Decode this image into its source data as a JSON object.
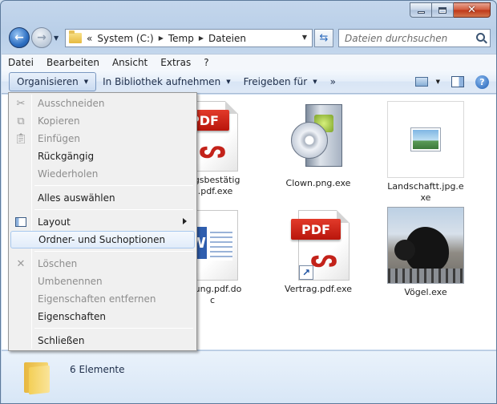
{
  "address": {
    "crumbs": [
      "System (C:)",
      "Temp",
      "Dateien"
    ],
    "leading_chevrons": "«"
  },
  "search": {
    "placeholder": "Dateien durchsuchen"
  },
  "menubar": [
    "Datei",
    "Bearbeiten",
    "Ansicht",
    "Extras",
    "?"
  ],
  "commandbar": {
    "organize": "Organisieren",
    "library": "In Bibliothek aufnehmen",
    "share": "Freigeben für",
    "more": "»"
  },
  "files": [
    {
      "name": "Auftragsbestätigung.pdf.exe",
      "visible_label": "ragsbestätig\ng.pdf.exe",
      "icon": "pdf-document-icon"
    },
    {
      "name": "Clown.png.exe",
      "visible_label": "Clown.png.exe",
      "icon": "software-box-icon"
    },
    {
      "name": "Landschaftt.jpg.exe",
      "visible_label": "Landschaftt.jpg.e\nxe",
      "icon": "image-file-icon"
    },
    {
      "name": "Rechnung.pdf.doc",
      "visible_label": "hnung.pdf.do\nc",
      "icon": "word-document-icon"
    },
    {
      "name": "Vertrag.pdf.exe",
      "visible_label": "Vertrag.pdf.exe",
      "icon": "pdf-shortcut-icon"
    },
    {
      "name": "Vögel.exe",
      "visible_label": "Vögel.exe",
      "icon": "photo-thumbnail"
    }
  ],
  "context_menu": {
    "items": [
      {
        "label": "Ausschneiden",
        "enabled": false,
        "icon": "scissors-icon"
      },
      {
        "label": "Kopieren",
        "enabled": false,
        "icon": "copy-icon"
      },
      {
        "label": "Einfügen",
        "enabled": false,
        "icon": "paste-icon"
      },
      {
        "label": "Rückgängig",
        "enabled": true
      },
      {
        "label": "Wiederholen",
        "enabled": false
      },
      {
        "label": "Alles auswählen",
        "enabled": true
      },
      {
        "label": "Layout",
        "enabled": true,
        "icon": "layout-icon",
        "submenu": true
      },
      {
        "label": "Ordner- und Suchoptionen",
        "enabled": true,
        "highlighted": true
      },
      {
        "label": "Löschen",
        "enabled": false,
        "icon": "delete-icon"
      },
      {
        "label": "Umbenennen",
        "enabled": false
      },
      {
        "label": "Eigenschaften entfernen",
        "enabled": false
      },
      {
        "label": "Eigenschaften",
        "enabled": true
      },
      {
        "label": "Schließen",
        "enabled": true
      }
    ]
  },
  "status": {
    "count_text": "6 Elemente"
  },
  "colors": {
    "accent": "#2d6fc2",
    "pdf_red": "#d21f14",
    "highlight": "#e1ecfa"
  }
}
